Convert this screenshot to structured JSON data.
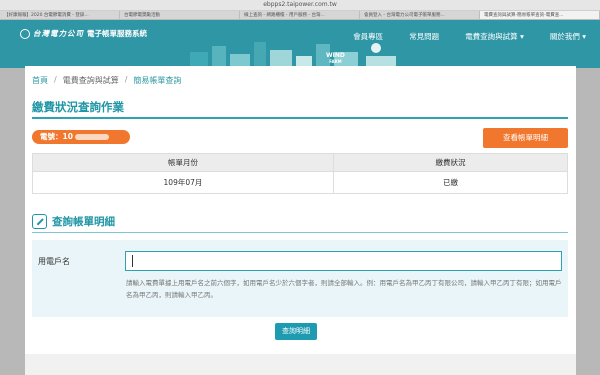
{
  "browser": {
    "url": "ebpps2.taipower.com.tw",
    "tabs": [
      "【好康報報】2020 台電節電消費 - 登錄...",
      "台電節電獎勵活動",
      "線上查詢 - 網路櫃檯 - 用戶服務 - 台灣...",
      "會員登入 - 台灣電力公司電子帳單服務...",
      "電費查詢與試算-簡易帳單查詢-電費查..."
    ],
    "active_tab_index": 4
  },
  "header": {
    "logo_text": "台灣電力公司",
    "logo_subtitle": "電子帳單服務系統",
    "nav": [
      "會員專區",
      "常見問題",
      "電費查詢與試算 ▾",
      "關於我們 ▾"
    ],
    "banner_text": "WIND",
    "banner_subtext": "FARM"
  },
  "breadcrumb": [
    "首頁",
    "電費查詢與試算",
    "簡易帳單查詢"
  ],
  "page_title": "繳費狀況查詢作業",
  "meter": {
    "label": "電號：",
    "number_prefix": "10"
  },
  "view_detail_button": "查看帳單明細",
  "table": {
    "headers": [
      "帳單月份",
      "繳費狀況"
    ],
    "rows": [
      [
        "109年07月",
        "已繳"
      ]
    ]
  },
  "query_section": {
    "title": "查詢帳單明細",
    "field_label": "用電戶名",
    "input_value": "",
    "hint": "請輸入電費單據上用電戶名之前六個字，如用電戶名少於六個字者，則請全部輸入。例：用電戶名為甲乙丙丁有限公司，請輸入甲乙丙丁有限；如用電戶名為甲乙丙，則請輸入甲乙丙。"
  },
  "submit_button": "查詢明細",
  "colors": {
    "header": "#2f96a6",
    "accent": "#1f95a5",
    "orange": "#f0772d"
  }
}
